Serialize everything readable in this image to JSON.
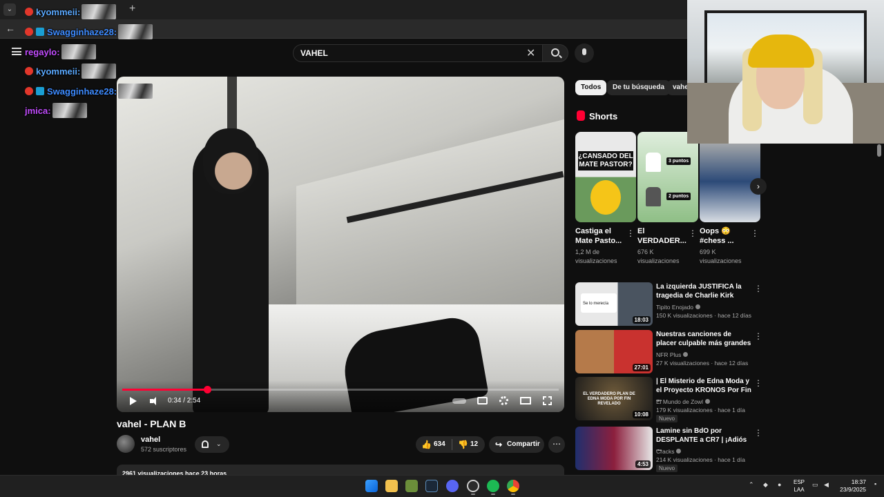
{
  "colors": {
    "accent": "#ff0033",
    "background": "#0f0f0f",
    "chip_active": "#f1f1f1"
  },
  "search": {
    "query": "VAHEL"
  },
  "video": {
    "title": "vahel - PLAN B",
    "time": "0:34 / 2:54",
    "progress_fraction": 0.195,
    "channel": "vahel",
    "subscribers": "572 suscriptores",
    "likes": "634",
    "dislikes": "12",
    "share_label": "Compartir",
    "description_preview": "2961 visualizaciones  hace 23 horas"
  },
  "chips": [
    "Todos",
    "De tu búsqueda",
    "vahe"
  ],
  "shorts": {
    "heading": "Shorts",
    "items": [
      {
        "title": "Castiga el Mate Pasto...",
        "views": "1,2 M de visualizaciones",
        "thumb_text": "¿CANSADO DEL MATE PASTOR?"
      },
      {
        "title": "El VERDADER...",
        "views": "676 K visualizaciones",
        "thumb_text_a": "3 puntos",
        "thumb_text_b": "2 puntos"
      },
      {
        "title": "Oops 😳 #chess ...",
        "views": "699 K visualizaciones"
      }
    ]
  },
  "recommendations": [
    {
      "title": "La izquierda JUSTIFICA la tragedia de Charlie Kirk",
      "channel": "Tipito Enojado",
      "meta": "150 K visualizaciones · hace 12 días",
      "duration": "18:03",
      "badge": "",
      "thumb_text": "Se lo merecía"
    },
    {
      "title": "Nuestras canciones de placer culpable más grandes",
      "channel": "NFR Plus",
      "meta": "27 K visualizaciones · hace 12 días",
      "duration": "27:01",
      "badge": ""
    },
    {
      "title": "| El Misterio de Edna Moda y el Proyecto KRONOS Por Fin ...",
      "channel": "El Mundo de Zowl",
      "meta": "179 K visualizaciones · hace 1 día",
      "duration": "10:08",
      "badge": "Nuevo",
      "thumb_text": "EL VERDADERO PLAN DE EDNA MODA POR FIN REVELADO"
    },
    {
      "title": "Lamine sin BdO por DESPLANTE a CR7 | ¡Adiós ...",
      "channel": "Cracks",
      "meta": "214 K visualizaciones · hace 1 día",
      "duration": "4:53",
      "badge": "Nuevo"
    }
  ],
  "chat": [
    {
      "user": "kyommeii:",
      "color": "#5aa9ff",
      "badge": "red"
    },
    {
      "user": "Swagginhaze28:",
      "color": "#3d8bff",
      "badge": "both"
    },
    {
      "user": "regaylo:",
      "color": "#c34dff",
      "badge": ""
    },
    {
      "user": "kyommeii:",
      "color": "#5aa9ff",
      "badge": "red"
    },
    {
      "user": "Swagginhaze28:",
      "color": "#3d8bff",
      "badge": "both"
    },
    {
      "user": "jmica:",
      "color": "#c34dff",
      "badge": ""
    }
  ],
  "taskbar": {
    "lang_top": "ESP",
    "lang_bottom": "LAA",
    "time": "18:37",
    "date": "23/9/2025",
    "icons": [
      "windows-start",
      "file-explorer",
      "app",
      "steam",
      "discord",
      "obs",
      "spotify",
      "chrome"
    ]
  }
}
